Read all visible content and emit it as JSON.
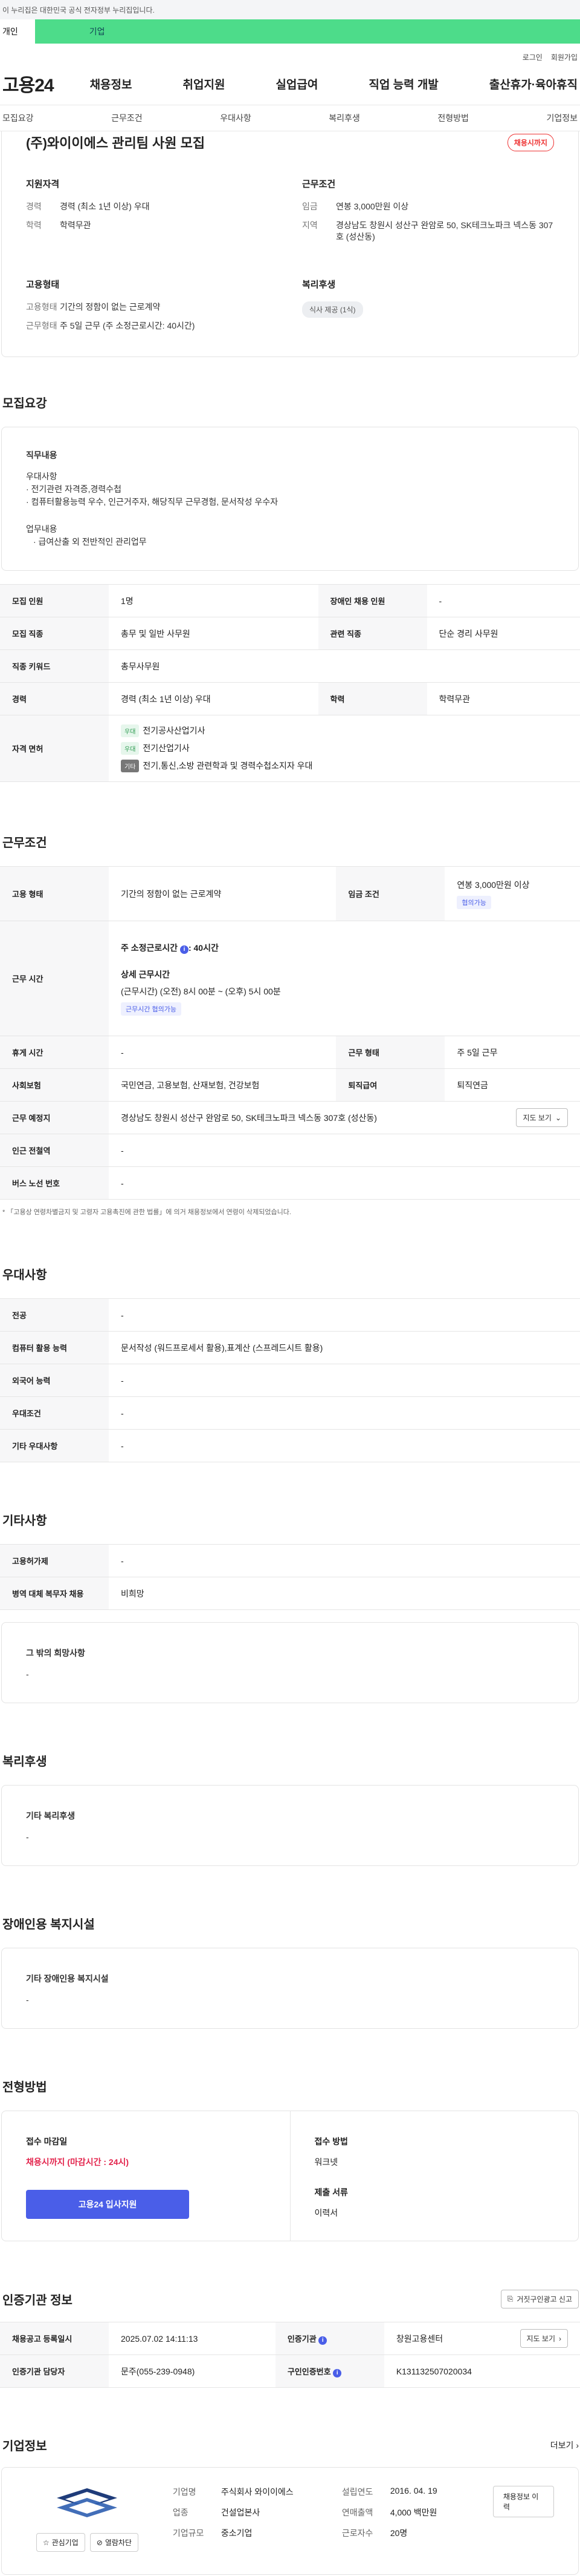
{
  "gov_banner": "이 누리집은 대한민국 공식 전자정부 누리집입니다.",
  "type_tabs": [
    "개인",
    "기업"
  ],
  "top_menu": [
    "로그인",
    "회원가입"
  ],
  "logo": "고용24",
  "gnb": [
    "채용정보",
    "취업지원",
    "실업급여",
    "직업 능력 개발",
    "출산휴가·육아휴직"
  ],
  "subnav": [
    "모집요강",
    "근무조건",
    "우대사항",
    "복리후생",
    "전형방법",
    "기업정보"
  ],
  "summary": {
    "title": "(주)와이이에스 관리팀 사원 모집",
    "status_badge": "채용시까지",
    "qualification": {
      "heading": "지원자격",
      "career_k": "경력",
      "career_v": "경력 (최소 1년 이상) 우대",
      "edu_k": "학력",
      "edu_v": "학력무관"
    },
    "conditions": {
      "heading": "근무조건",
      "wage_k": "임금",
      "wage_v": "연봉 3,000만원 이상",
      "loc_k": "지역",
      "loc_v": "경상남도 창원시 성산구 완암로 50, SK테크노파크 넥스동 307호 (성산동)"
    },
    "employment": {
      "heading": "고용형태",
      "type_k": "고용형태",
      "type_v": "기간의 정함이 없는 근로계약",
      "form_k": "근무형태",
      "form_v": "주 5일 근무 (주 소정근로시간: 40시간)"
    },
    "welfare": {
      "heading": "복리후생",
      "pill": "식사 제공 (1식)"
    }
  },
  "recruit": {
    "title": "모집요강",
    "duty_heading": "직무내용",
    "duty_lines": [
      "우대사항",
      "· 전기관련 자격증,경력수첩",
      "· 컴퓨터활용능력 우수, 인근거주자, 해당직무 근무경험, 문서작성 우수자"
    ],
    "work_heading": "업무내용",
    "work_lines": [
      "  · 급여산출 외 전반적인 관리업무"
    ],
    "table": {
      "r1": [
        "모집 인원",
        "1명",
        "장애인 채용 인원",
        "-"
      ],
      "r2": [
        "모집 직종",
        "총무 및 일반 사무원",
        "관련 직종",
        "단순 경리 사무원"
      ],
      "r3": [
        "직종 키워드",
        "총무사무원"
      ],
      "r4": [
        "경력",
        "경력 (최소 1년 이상) 우대",
        "학력",
        "학력무관"
      ],
      "lic_k": "자격 면허",
      "licenses": [
        {
          "tag": "우대",
          "text": "전기공사산업기사"
        },
        {
          "tag": "우대",
          "text": "전기산업기사"
        },
        {
          "tag": "기타",
          "text": "전기,통신,소방 관련학과 및 경력수첩소지자 우대"
        }
      ]
    }
  },
  "work": {
    "title": "근무조건",
    "emp_type_k": "고용 형태",
    "emp_type_v": "기간의 정함이 없는 근로계약",
    "wage_k": "임금 조건",
    "wage_v": "연봉 3,000만원 이상",
    "wage_tag": "협의가능",
    "hours_k": "근무 시간",
    "hours_weekly": "주 소정근로시간",
    "hours_weekly_v": ": 40시간",
    "hours_detail_h": "상세 근무시간",
    "hours_detail_v": "(근무시간) (오전) 8시 00분 ~ (오후) 5시 00분",
    "hours_tag": "근무시간 협의가능",
    "rest_k": "휴게 시간",
    "rest_v": "-",
    "form_k": "근무 형태",
    "form_v": "주 5일 근무",
    "ins_k": "사회보험",
    "ins_v": "국민연금, 고용보험, 산재보험, 건강보험",
    "sev_k": "퇴직급여",
    "sev_v": "퇴직연금",
    "loc_k": "근무 예정지",
    "loc_v": "경상남도 창원시 성산구 완암로 50, SK테크노파크 넥스동 307호 (성산동)",
    "map_btn": "지도 보기",
    "subway_k": "인근 전철역",
    "subway_v": "-",
    "bus_k": "버스 노선 번호",
    "bus_v": "-",
    "note": "* 「고용상 연령차별금지 및 고령자 고용촉진에 관한 법률」에 의거 채용정보에서 연령이 삭제되었습니다."
  },
  "preference": {
    "title": "우대사항",
    "rows": [
      [
        "전공",
        "-"
      ],
      [
        "컴퓨터 활용 능력",
        "문서작성 (워드프로세서 활용),표계산 (스프레드시트 활용)"
      ],
      [
        "외국어 능력",
        "-"
      ],
      [
        "우대조건",
        "-"
      ],
      [
        "기타 우대사항",
        "-"
      ]
    ]
  },
  "etc": {
    "title": "기타사항",
    "rows": [
      [
        "고용허가제",
        "-"
      ],
      [
        "병역 대체 복무자 채용",
        "비희망"
      ]
    ],
    "other_h": "그 밖의 희망사항",
    "other_v": "-"
  },
  "welfare": {
    "title": "복리후생",
    "h": "기타 복리후생",
    "v": "-"
  },
  "disabled": {
    "title": "장애인용 복지시설",
    "h": "기타 장애인용 복지시설",
    "v": "-"
  },
  "selection": {
    "title": "전형방법",
    "deadline_h": "접수 마감일",
    "deadline_v": "채용시까지 (마감시간 : 24시)",
    "apply_btn": "고용24 입사지원",
    "method_h": "접수 방법",
    "method_v": "워크넷",
    "docs_h": "제출 서류",
    "docs_v": "이력서"
  },
  "agency": {
    "title": "인증기관 정보",
    "report_btn": "거짓구인광고 신고",
    "reg_k": "채용공고 등록일시",
    "reg_v": "2025.07.02 14:11:13",
    "agency_k": "인증기관",
    "agency_v": "창원고용센터",
    "map_btn": "지도 보기",
    "staff_k": "인증기관 담당자",
    "staff_v": "문주(055-239-0948)",
    "no_k": "구인인증번호",
    "no_v": "K131132507020034"
  },
  "company": {
    "title": "기업정보",
    "more": "더보기",
    "fav_btn": "관심기업",
    "block_btn": "열람차단",
    "name_k": "기업명",
    "name_v": "주식회사 와이이에스",
    "ind_k": "업종",
    "ind_v": "건설업본사",
    "size_k": "기업규모",
    "size_v": "중소기업",
    "year_k": "설립연도",
    "year_v": "2016. 04. 19",
    "sales_k": "연매출액",
    "sales_v": "4,000 백만원",
    "emp_k": "근로자수",
    "emp_v": "20명",
    "jobs_btn": "채용정보 이력"
  },
  "colors": {
    "accent": "#4a5ee8",
    "tab_green": "#4ddc8a",
    "deadline_red": "#e3254d"
  }
}
